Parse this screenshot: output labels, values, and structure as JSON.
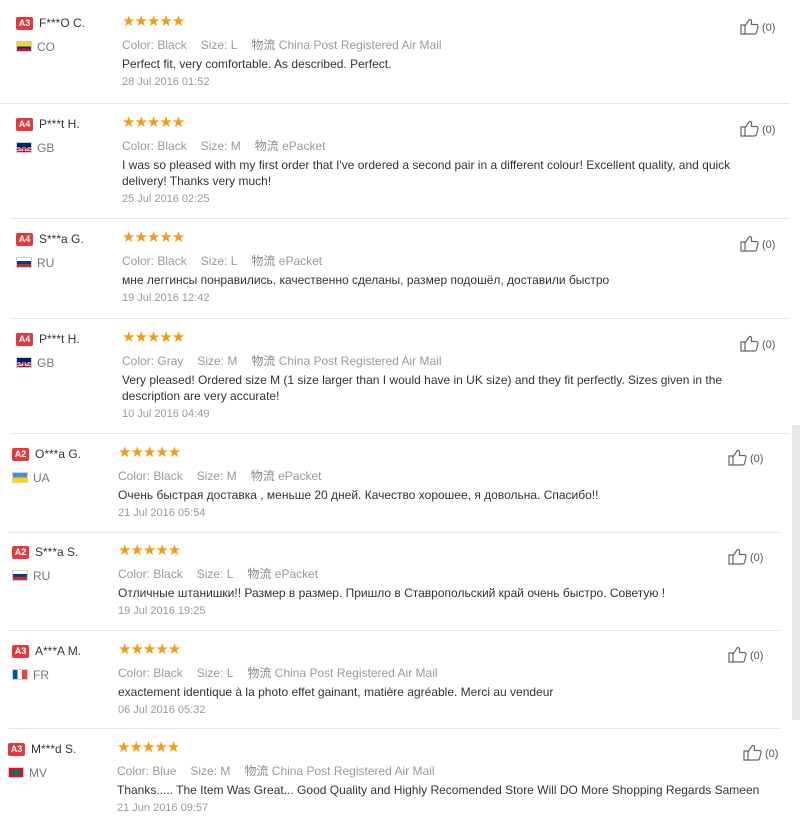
{
  "labels": {
    "color": "Color:",
    "size": "Size:",
    "shipping_prefix": "物流"
  },
  "reviews": [
    {
      "level": "A3",
      "user": "F***O C.",
      "country": "CO",
      "flag": "co",
      "color": "Black",
      "size": "L",
      "shipping": "China Post Registered Air Mail",
      "text": "Perfect fit, very comfortable. As described. Perfect.",
      "date": "28 Jul 2016 01:52",
      "likes": "(0)"
    },
    {
      "level": "A4",
      "user": "P***t H.",
      "country": "GB",
      "flag": "gb",
      "color": "Black",
      "size": "M",
      "shipping": "ePacket",
      "text": "I was so pleased with my first order that I've ordered a second pair in a different colour! Excellent quality, and quick delivery! Thanks very much!",
      "date": "25 Jul 2016 02:25",
      "likes": "(0)"
    },
    {
      "level": "A4",
      "user": "S***a G.",
      "country": "RU",
      "flag": "ru",
      "color": "Black",
      "size": "L",
      "shipping": "ePacket",
      "text": "мне леггинсы понравились. качественно сделаны, размер подошёл, доставили быстро",
      "date": "19 Jul 2016 12:42",
      "likes": "(0)"
    },
    {
      "level": "A4",
      "user": "P***t H.",
      "country": "GB",
      "flag": "gb",
      "color": "Gray",
      "size": "M",
      "shipping": "China Post Registered Air Mail",
      "text": "Very pleased! Ordered size M (1 size larger than I would have in UK size) and they fit perfectly. Sizes given in the description are very accurate!",
      "date": "10 Jul 2016 04:49",
      "likes": "(0)"
    },
    {
      "level": "A2",
      "user": "O***a G.",
      "country": "UA",
      "flag": "ua",
      "color": "Black",
      "size": "M",
      "shipping": "ePacket",
      "text": "Очень быстрая доставка , меньше 20 дней. Качество хорошее, я довольна. Спасибо!!",
      "date": "21 Jul 2016 05:54",
      "likes": "(0)"
    },
    {
      "level": "A2",
      "user": "S***a S.",
      "country": "RU",
      "flag": "ru",
      "color": "Black",
      "size": "L",
      "shipping": "ePacket",
      "text": "Отличные штанишки!! Размер в размер. Пришло в Ставропольский край очень быстро. Советую !",
      "date": "19 Jul 2016 19:25",
      "likes": "(0)"
    },
    {
      "level": "A3",
      "user": "A***A M.",
      "country": "FR",
      "flag": "fr",
      "color": "Black",
      "size": "L",
      "shipping": "China Post Registered Air Mail",
      "text": "exactement identique à la photo effet gainant, matière agréable. Merci au vendeur",
      "date": "06 Jul 2016 05:32",
      "likes": "(0)"
    },
    {
      "level": "A3",
      "user": "M***d S.",
      "country": "MV",
      "flag": "mv",
      "color": "Blue",
      "size": "M",
      "shipping": "China Post Registered Air Mail",
      "text": "Thanks..... The Item Was Great... Good Quality and Highly Recomended Store Will DO More Shopping Regards Sameen",
      "date": "21 Jun 2016 09:57",
      "likes": "(0)"
    }
  ],
  "stars_glyph": "★★★★★"
}
